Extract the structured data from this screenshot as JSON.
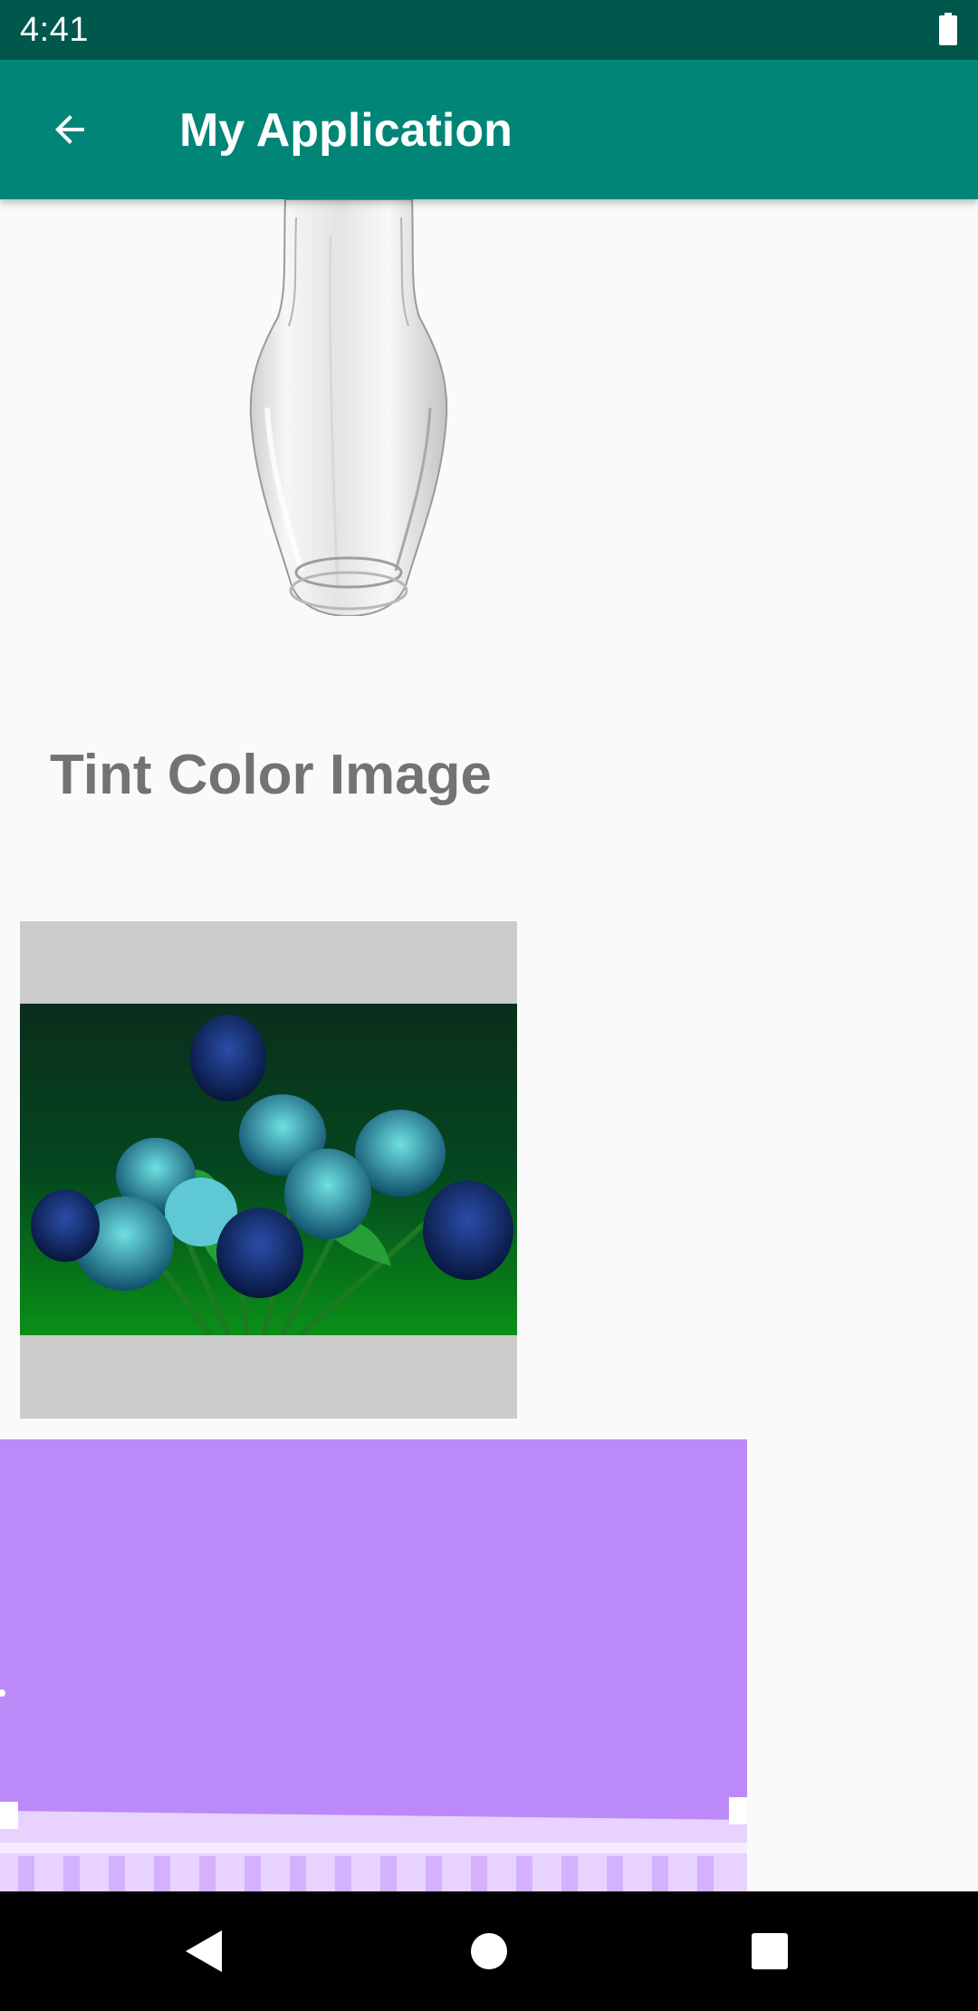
{
  "status_bar": {
    "time": "4:41",
    "battery_icon": "battery-full-icon"
  },
  "app_bar": {
    "back_icon": "arrow-back-icon",
    "title": "My Application",
    "color": "#008577",
    "status_color": "#00574b"
  },
  "content": {
    "vase_image": "glass-vase-image",
    "section_title": "Tint Color Image",
    "tinted_image": "tinted-tulips-image",
    "tinted_image_background": "#cccccc",
    "purple_image": "purple-tinted-building-image",
    "purple_tint": "#bc89f8"
  },
  "nav_bar": {
    "back_icon": "nav-back-icon",
    "home_icon": "nav-home-icon",
    "recents_icon": "nav-recents-icon"
  }
}
